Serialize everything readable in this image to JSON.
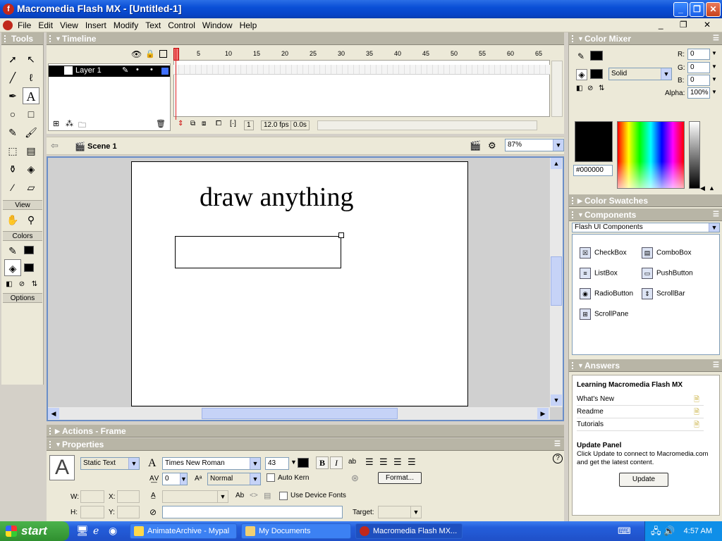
{
  "window": {
    "app_icon": "flash-logo-icon",
    "title": "Macromedia Flash MX - [Untitled-1]",
    "controls": [
      "minimize-icon",
      "maximize-icon",
      "close-icon"
    ]
  },
  "menu": {
    "items": [
      "File",
      "Edit",
      "View",
      "Insert",
      "Modify",
      "Text",
      "Control",
      "Window",
      "Help"
    ]
  },
  "tools": {
    "title": "Tools",
    "view_label": "View",
    "colors_label": "Colors",
    "options_label": "Options"
  },
  "timeline": {
    "title": "Timeline",
    "layer_name": "Layer 1",
    "frame_numbers": [
      "1",
      "5",
      "10",
      "15",
      "20",
      "25",
      "30",
      "35",
      "40",
      "45",
      "50",
      "55",
      "60",
      "65"
    ],
    "current_frame": "1",
    "fps": "12.0 fps",
    "elapsed": "0.0s"
  },
  "scene": {
    "name": "Scene 1",
    "zoom": "87%"
  },
  "stage": {
    "text": "draw anything"
  },
  "panels": {
    "actions": "Actions - Frame",
    "properties": "Properties"
  },
  "properties": {
    "text_type": "Static Text",
    "font": "Times New Roman",
    "font_size": "43",
    "bold": "B",
    "italic": "I",
    "tracking": "0",
    "baseline": "Normal",
    "auto_kern": "Auto Kern",
    "format_button": "Format...",
    "use_device_fonts": "Use Device Fonts",
    "w_label": "W:",
    "h_label": "H:",
    "x_label": "X:",
    "y_label": "Y:",
    "target_label": "Target:",
    "help": "?"
  },
  "color_mixer": {
    "title": "Color Mixer",
    "fill_type": "Solid",
    "r_label": "R:",
    "g_label": "G:",
    "b_label": "B:",
    "alpha_label": "Alpha:",
    "r": "0",
    "g": "0",
    "b": "0",
    "alpha": "100%",
    "hex": "#000000"
  },
  "color_swatches": {
    "title": "Color Swatches"
  },
  "components": {
    "title": "Components",
    "set": "Flash UI Components",
    "items": [
      "CheckBox",
      "ComboBox",
      "ListBox",
      "PushButton",
      "RadioButton",
      "ScrollBar",
      "ScrollPane"
    ]
  },
  "answers": {
    "title": "Answers",
    "heading": "Learning Macromedia Flash MX",
    "links": [
      "What's New",
      "Readme",
      "Tutorials"
    ],
    "update_title": "Update Panel",
    "update_text": "Click Update to connect to Macromedia.com and get the latest content.",
    "update_button": "Update"
  },
  "taskbar": {
    "start": "start",
    "tasks": [
      "AnimateArchive - Mypal",
      "My Documents",
      "Macromedia Flash MX..."
    ],
    "clock": "4:57 AM"
  }
}
